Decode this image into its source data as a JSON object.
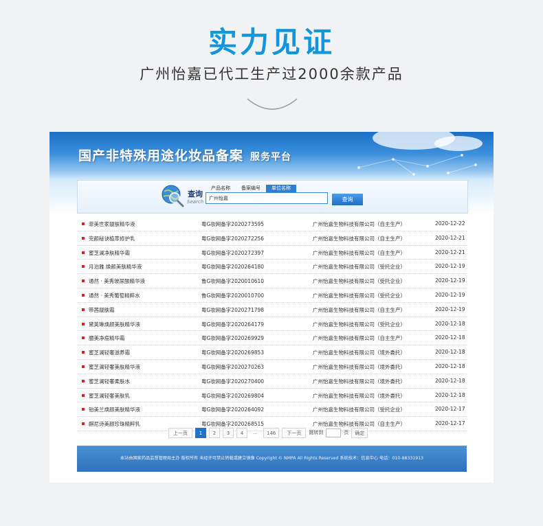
{
  "hero": {
    "title": "实力见证",
    "subtitle": "广州怡嘉已代工生产过2000余款产品"
  },
  "banner": {
    "title": "国产非特殊用途化妆品备案",
    "title_suffix": "服务平台"
  },
  "search": {
    "label": "查询",
    "label_sub": "Search",
    "tabs": [
      "产品名称",
      "备案编号",
      "单位名称"
    ],
    "active_tab": "单位名称",
    "input_value": "广州怡嘉",
    "button_label": "查询",
    "icon": "globe-magnifier-icon"
  },
  "records": [
    {
      "name": "菲美世家靓肤精华液",
      "reg": "粤G妆网备字2020273595",
      "company": "广州怡嘉生物科技有限公司（自主生产）",
      "date": "2020-12-22"
    },
    {
      "name": "完颜秘诀植萃修护乳",
      "reg": "粤G妆网备字2020272256",
      "company": "广州怡嘉生物科技有限公司（自主生产）",
      "date": "2020-12-21"
    },
    {
      "name": "蜜芝澜净肤精华霜",
      "reg": "粤G妆网备字2020272397",
      "company": "广州怡嘉生物科技有限公司（自主生产）",
      "date": "2020-12-21"
    },
    {
      "name": "月泊雅 焕颜美肤精华液",
      "reg": "粤G妆网备字2020264180",
      "company": "广州怡嘉生物科技有限公司（受托企业）",
      "date": "2020-12-19"
    },
    {
      "name": "通然 · 美秀玻尿酸精华液",
      "reg": "鲁G妆网备字2020010610",
      "company": "广州怡嘉生物科技有限公司（受托企业）",
      "date": "2020-12-19"
    },
    {
      "name": "通然 · 美秀葡萄精粹水",
      "reg": "鲁G妆网备字2020010700",
      "company": "广州怡嘉生物科技有限公司（受托企业）",
      "date": "2020-12-19"
    },
    {
      "name": "带茜靓肤霜",
      "reg": "粤G妆网备字2020271798",
      "company": "广州怡嘉生物科技有限公司（自主生产）",
      "date": "2020-12-19"
    },
    {
      "name": "黛荚琳焕颜美肤精华液",
      "reg": "粤G妆网备字2020264179",
      "company": "广州怡嘉生物科技有限公司（受托企业）",
      "date": "2020-12-18"
    },
    {
      "name": "臆美净痘精华霜",
      "reg": "粤G妆网备字2020269929",
      "company": "广州怡嘉生物科技有限公司（自主生产）",
      "date": "2020-12-18"
    },
    {
      "name": "蜜芝澜轻奢滋养霜",
      "reg": "粤G妆网备字2020269853",
      "company": "广州怡嘉生物科技有限公司（境外委托）",
      "date": "2020-12-18"
    },
    {
      "name": "蜜芝澜轻奢美肤精华液",
      "reg": "粤G妆网备字2020270263",
      "company": "广州怡嘉生物科技有限公司（境外委托）",
      "date": "2020-12-18"
    },
    {
      "name": "蜜芝澜轻奢柔肤水",
      "reg": "粤G妆网备字2020270400",
      "company": "广州怡嘉生物科技有限公司（境外委托）",
      "date": "2020-12-18"
    },
    {
      "name": "蜜芝澜轻奢美肤乳",
      "reg": "粤G妆网备字2020269804",
      "company": "广州怡嘉生物科技有限公司（境外委托）",
      "date": "2020-12-18"
    },
    {
      "name": "铂美兰焕颜美肤精华液",
      "reg": "粤G妆网备字2020264092",
      "company": "广州怡嘉生物科技有限公司（受托企业）",
      "date": "2020-12-17"
    },
    {
      "name": "麒尼诗美颜珍珠精粹乳",
      "reg": "粤G妆网备字2020268515",
      "company": "广州怡嘉生物科技有限公司（自主生产）",
      "date": "2020-12-17"
    }
  ],
  "pagination": {
    "prev": "上一页",
    "pages": [
      "1",
      "2",
      "3",
      "4"
    ],
    "current": "1",
    "ellipsis": "…",
    "last": "146",
    "next": "下一页",
    "jump_prefix": "跳转到",
    "jump_suffix": "页",
    "confirm": "确定"
  },
  "footer": {
    "text": "本站由国家药品监督管理局主办 版权所有 未经许可禁止转载或建立镜像 Copyright © NMPA All Rights Reserved 系统技术：信息中心 电话：010-88331913"
  },
  "colors": {
    "accent": "#1296db",
    "banner_blue": "#2f7fd0",
    "bullet_red": "#d9251c"
  }
}
